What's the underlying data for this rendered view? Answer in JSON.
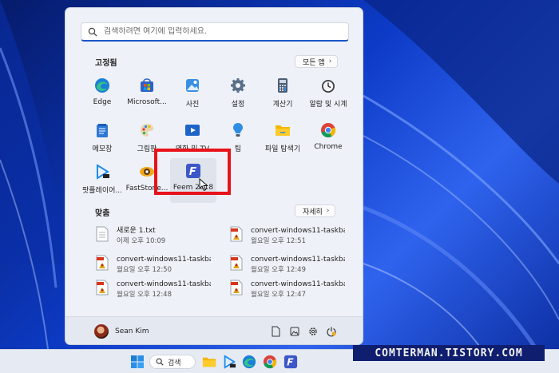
{
  "search": {
    "placeholder": "검색하려면 여기에 입력하세요."
  },
  "pinned": {
    "title": "고정됨",
    "all_apps_label": "모든 앱",
    "apps": [
      {
        "label": "Edge",
        "icon": "edge-icon"
      },
      {
        "label": "Microsoft...",
        "icon": "microsoft-store-icon"
      },
      {
        "label": "사진",
        "icon": "photos-icon"
      },
      {
        "label": "설정",
        "icon": "settings-gear-icon"
      },
      {
        "label": "계산기",
        "icon": "calculator-icon"
      },
      {
        "label": "알람 및 시계",
        "icon": "alarm-clock-icon"
      },
      {
        "label": "메모장",
        "icon": "notepad-icon"
      },
      {
        "label": "그림판",
        "icon": "paint-icon"
      },
      {
        "label": "영화 및 TV",
        "icon": "movies-tv-icon"
      },
      {
        "label": "팁",
        "icon": "tips-icon"
      },
      {
        "label": "파일 탐색기",
        "icon": "file-explorer-icon"
      },
      {
        "label": "Chrome",
        "icon": "chrome-icon"
      },
      {
        "label": "팟플레이어...",
        "icon": "potplayer-icon"
      },
      {
        "label": "FastStone...",
        "icon": "faststone-icon"
      },
      {
        "label": "Feem 2018",
        "icon": "feem-icon"
      }
    ]
  },
  "recommended": {
    "title": "맞춤",
    "more_label": "자세히",
    "items": [
      {
        "name": "새로운 1.txt",
        "time": "어제 오후 10:09",
        "icon": "text-file-icon"
      },
      {
        "name": "convert-windows11-taskbar...",
        "time": "월요일 오후 12:51",
        "icon": "image-file-icon"
      },
      {
        "name": "convert-windows11-taskbar...",
        "time": "월요일 오후 12:50",
        "icon": "image-file-icon"
      },
      {
        "name": "convert-windows11-taskbar...",
        "time": "월요일 오후 12:49",
        "icon": "image-file-icon"
      },
      {
        "name": "convert-windows11-taskbar...",
        "time": "월요일 오후 12:48",
        "icon": "image-file-icon"
      },
      {
        "name": "convert-windows11-taskbar...",
        "time": "월요일 오후 12:47",
        "icon": "image-file-icon"
      }
    ]
  },
  "user": {
    "name": "Sean Kim"
  },
  "taskbar": {
    "search_label": "검색"
  },
  "watermark": "COMTERMAN.TISTORY.COM",
  "colors": {
    "accent": "#1a56c8",
    "highlight_box": "#e8121b",
    "feem": "#3d57c9"
  }
}
